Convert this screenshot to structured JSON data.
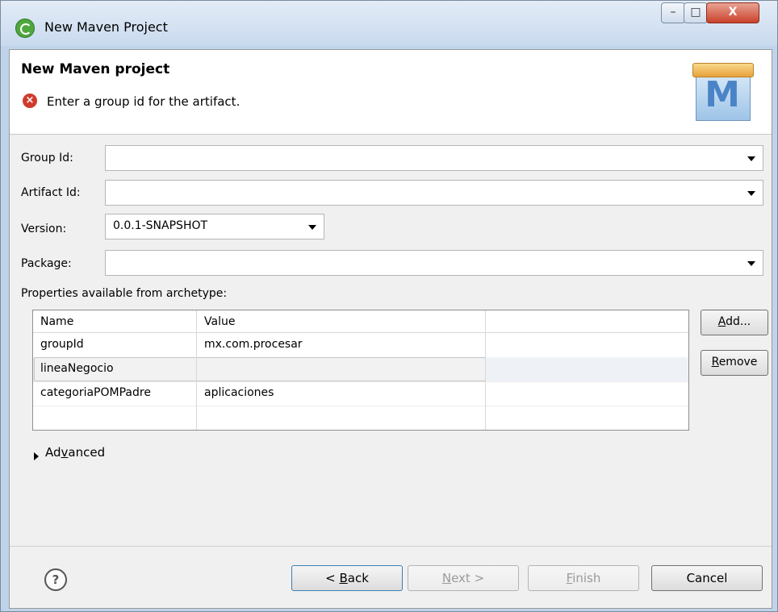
{
  "window": {
    "title": "New Maven Project",
    "controls": {
      "minimize": "–",
      "maximize": "□",
      "close": "X"
    }
  },
  "banner": {
    "title": "New Maven project",
    "message": "Enter a group id for the artifact.",
    "logo_letter": "M"
  },
  "form": {
    "group_id": {
      "label": "Group Id:",
      "value": ""
    },
    "artifact_id": {
      "label": "Artifact Id:",
      "value": ""
    },
    "version": {
      "label": "Version:",
      "value": "0.0.1-SNAPSHOT"
    },
    "package": {
      "label": "Package:",
      "value": ""
    }
  },
  "properties": {
    "section_label": "Properties available from archetype:",
    "columns": [
      "Name",
      "Value"
    ],
    "rows": [
      {
        "name": "groupId",
        "value": "mx.com.procesar"
      },
      {
        "name": "lineaNegocio",
        "value": ""
      },
      {
        "name": "categoriaPOMPadre",
        "value": "aplicaciones"
      }
    ],
    "add_button": {
      "accel": "A",
      "rest": "dd..."
    },
    "remove_button": {
      "accel": "R",
      "rest": "emove"
    }
  },
  "advanced": {
    "pre": "Ad",
    "accel": "v",
    "post": "anced"
  },
  "footer": {
    "help_symbol": "?",
    "back": {
      "pre": "< ",
      "accel": "B",
      "post": "ack"
    },
    "next": {
      "accel": "N",
      "post": "ext >"
    },
    "finish": {
      "accel": "F",
      "post": "inish"
    },
    "cancel": "Cancel"
  },
  "colors": {
    "error_red": "#d13b2c",
    "titlebar": "#c9daee",
    "panel": "#f0f0f0"
  }
}
